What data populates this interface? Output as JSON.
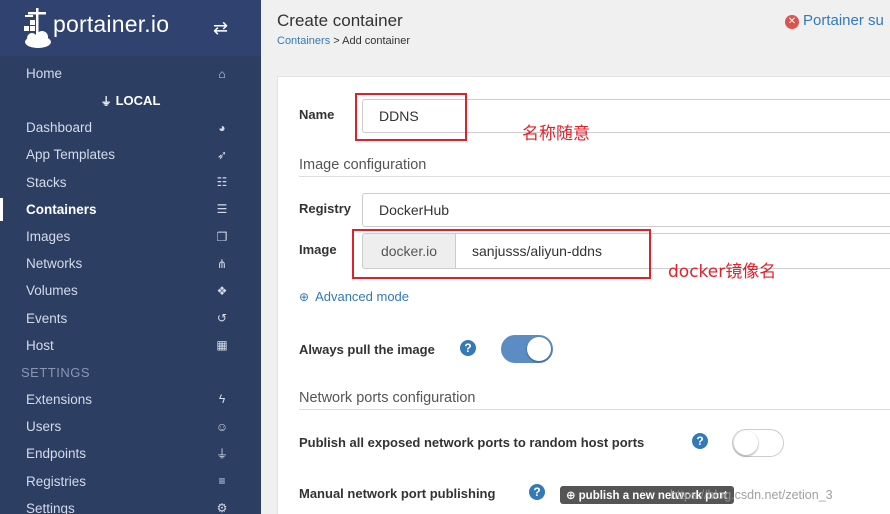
{
  "brand": {
    "name": "portainer.io"
  },
  "sidebar": {
    "home": {
      "label": "Home"
    },
    "endpoint_header": "LOCAL",
    "items": [
      {
        "label": "Dashboard",
        "icon": "tachometer-icon",
        "glyph": "◕"
      },
      {
        "label": "App Templates",
        "icon": "rocket-icon",
        "glyph": "➶"
      },
      {
        "label": "Stacks",
        "icon": "th-list-icon",
        "glyph": "☷"
      },
      {
        "label": "Containers",
        "icon": "server-icon",
        "glyph": "☰",
        "active": true
      },
      {
        "label": "Images",
        "icon": "clone-icon",
        "glyph": "❐"
      },
      {
        "label": "Networks",
        "icon": "sitemap-icon",
        "glyph": "⋔"
      },
      {
        "label": "Volumes",
        "icon": "cubes-icon",
        "glyph": "❖"
      },
      {
        "label": "Events",
        "icon": "history-icon",
        "glyph": "↺"
      },
      {
        "label": "Host",
        "icon": "th-icon",
        "glyph": "▦"
      }
    ],
    "settings_header": "SETTINGS",
    "settings_items": [
      {
        "label": "Extensions",
        "icon": "bolt-icon",
        "glyph": "ϟ"
      },
      {
        "label": "Users",
        "icon": "users-icon",
        "glyph": "☺"
      },
      {
        "label": "Endpoints",
        "icon": "plug-icon",
        "glyph": "⏚"
      },
      {
        "label": "Registries",
        "icon": "database-icon",
        "glyph": "≡"
      },
      {
        "label": "Settings",
        "icon": "cogs-icon",
        "glyph": "⚙"
      }
    ]
  },
  "header": {
    "title": "Create container",
    "breadcrumb_link": "Containers",
    "breadcrumb_sep": " > ",
    "breadcrumb_current": "Add container",
    "status": "Portainer su"
  },
  "form": {
    "name_label": "Name",
    "name_value": "DDNS",
    "image_config_title": "Image configuration",
    "registry_label": "Registry",
    "registry_value": "DockerHub",
    "image_label": "Image",
    "image_prefix": "docker.io",
    "image_value": "sanjusss/aliyun-ddns",
    "advanced_mode": "Advanced mode",
    "always_pull_label": "Always pull the image",
    "always_pull": true,
    "network_ports_title": "Network ports configuration",
    "publish_all_label": "Publish all exposed network ports to random host ports",
    "publish_all": false,
    "manual_publish_label": "Manual network port publishing",
    "publish_button": "publish a new network port"
  },
  "annotations": {
    "name_note": "名称随意",
    "image_note": "docker镜像名"
  },
  "watermark": "https://blog.csdn.net/zetion_3",
  "colors": {
    "sidebar_bg": "#2d3e63",
    "accent": "#337ab7",
    "annotation": "#e0202a",
    "toggle_on": "#5b8dc4"
  }
}
